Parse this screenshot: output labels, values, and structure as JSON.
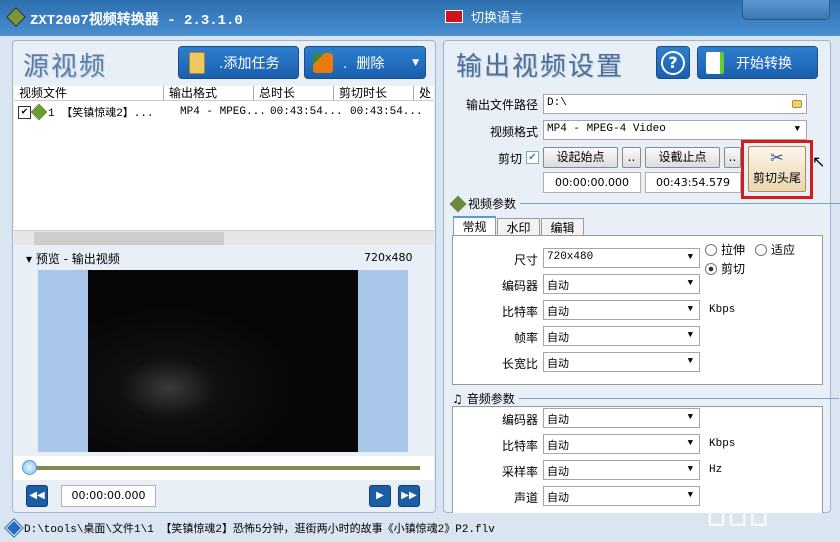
{
  "app": {
    "title": "ZXT2007视频转换器 - 2.3.1.0",
    "language_button": "切换语言"
  },
  "left": {
    "title": "源视频",
    "add_task": ".添加任务",
    "delete": ".  删除",
    "columns": [
      "视频文件",
      "输出格式",
      "总时长",
      "剪切时长",
      "处"
    ],
    "rows": [
      {
        "checked": true,
        "name": "1 【笑镇惊魂2】...",
        "format": "MP4 - MPEG...",
        "total": "00:43:54...",
        "cut": "00:43:54..."
      }
    ],
    "preview_label": "预览 - 输出视频",
    "preview_size": "720x480",
    "playback_time": "00:00:00.000",
    "progress": 0
  },
  "right": {
    "title": "输出视频设置",
    "help": "?",
    "start": "开始转换",
    "path_label": "输出文件路径",
    "path_value": "D:\\",
    "format_label": "视频格式",
    "format_value": "MP4 - MPEG-4 Video",
    "cut_label": "剪切",
    "cut_checked": true,
    "set_start": "设起始点",
    "set_end": "设截止点",
    "dots": "..",
    "start_time": "00:00:00.000",
    "end_time": "00:43:54.579",
    "cut_head_tail": "剪切头尾",
    "video_params": "视频参数",
    "tabs": [
      "常规",
      "水印",
      "编辑"
    ],
    "size_label": "尺寸",
    "size_value": "720x480",
    "radio_stretch": "拉伸",
    "radio_fit": "适应",
    "radio_crop": "剪切",
    "vparams": [
      {
        "label": "编码器",
        "value": "自动",
        "unit": ""
      },
      {
        "label": "比特率",
        "value": "自动",
        "unit": "Kbps"
      },
      {
        "label": "帧率",
        "value": "自动",
        "unit": ""
      },
      {
        "label": "长宽比",
        "value": "自动",
        "unit": ""
      }
    ],
    "audio_params": "音频参数",
    "aparams": [
      {
        "label": "编码器",
        "value": "自动",
        "unit": ""
      },
      {
        "label": "比特率",
        "value": "自动",
        "unit": "Kbps"
      },
      {
        "label": "采样率",
        "value": "自动",
        "unit": "Hz"
      },
      {
        "label": "声道",
        "value": "自动",
        "unit": ""
      }
    ]
  },
  "status": "D:\\tools\\桌面\\文件1\\1 【笑镇惊魂2】恐怖5分钟，逛街两小时的故事《小镇惊魂2》P2.flv",
  "watermark": "下载吧"
}
